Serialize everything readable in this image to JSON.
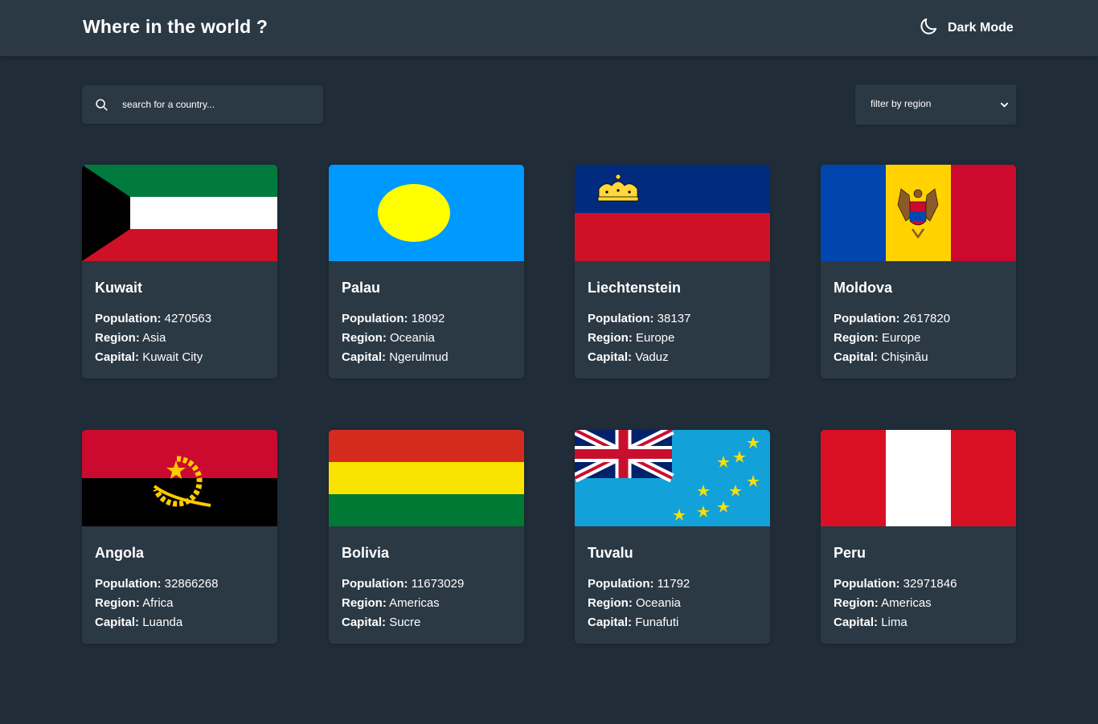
{
  "header": {
    "title": "Where in the world ?",
    "mode_label": "Dark Mode",
    "mode_icon": "moon-icon"
  },
  "search": {
    "placeholder": "search for a country...",
    "icon": "search-icon"
  },
  "filter": {
    "label": "filter by region",
    "icon": "chevron-down-icon"
  },
  "field_labels": {
    "population": "Population:",
    "region": "Region:",
    "capital": "Capital:"
  },
  "countries": [
    {
      "name": "Kuwait",
      "population": "4270563",
      "region": "Asia",
      "capital": "Kuwait City"
    },
    {
      "name": "Palau",
      "population": "18092",
      "region": "Oceania",
      "capital": "Ngerulmud"
    },
    {
      "name": "Liechtenstein",
      "population": "38137",
      "region": "Europe",
      "capital": "Vaduz"
    },
    {
      "name": "Moldova",
      "population": "2617820",
      "region": "Europe",
      "capital": "Chișinău"
    },
    {
      "name": "Angola",
      "population": "32866268",
      "region": "Africa",
      "capital": "Luanda"
    },
    {
      "name": "Bolivia",
      "population": "11673029",
      "region": "Americas",
      "capital": "Sucre"
    },
    {
      "name": "Tuvalu",
      "population": "11792",
      "region": "Oceania",
      "capital": "Funafuti"
    },
    {
      "name": "Peru",
      "population": "32971846",
      "region": "Americas",
      "capital": "Lima"
    }
  ],
  "colors": {
    "background": "#202c37",
    "elements": "#2b3945",
    "text": "#ffffff"
  }
}
